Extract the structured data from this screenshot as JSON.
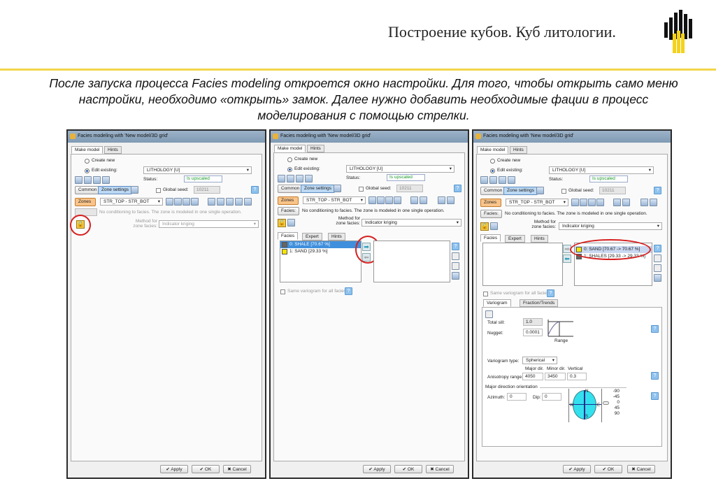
{
  "slide": {
    "title": "Построение кубов. Куб литологии.",
    "intro": "После запуска процесса Facies modeling откроется окно настройки. Для того, чтобы открыть само меню настройки, необходимо «открыть» замок. Далее нужно добавить необходимые фации в процесс моделирования с помощью стрелки.",
    "logo": "Rosneft logo"
  },
  "dialog": {
    "title": "Facies modeling with 'New model/3D grid'",
    "tab_make": "Make model",
    "tab_hints": "Hints",
    "create_new": "Create new",
    "edit_existing": "Edit existing:",
    "property": "LITHOLOGY [U]",
    "status_label": "Status:",
    "status_value": "Is upscaled",
    "common": "Common",
    "zone_settings": "Zone settings",
    "global_seed": "Global seed:",
    "seed_value": "10211",
    "zones": "Zones",
    "zone_value": "STR_TOP - STR_BOT",
    "facies_btn": "Facies:",
    "no_conditioning": "No conditioning to facies. The zone is modeled in one single operation.",
    "method_label": "Method for zone facies:",
    "method_value": "Indicator kriging",
    "apply": "Apply",
    "ok": "OK",
    "cancel": "Cancel"
  },
  "facies_tabs": {
    "facies": "Facies",
    "expert": "Expert",
    "hints": "Hints",
    "same_variogram": "Same variogram for all facies"
  },
  "dialog2": {
    "left_list": [
      {
        "label": "0: SHALE [70.67 %]",
        "color": "#666666"
      },
      {
        "label": "1: SAND [29.33 %]",
        "color": "#f5e400"
      }
    ]
  },
  "dialog3": {
    "right_list": [
      {
        "label": "0: SAND [70.67 -> 70.67 %]",
        "color": "#f5e400"
      },
      {
        "label": "1: SHALES [29.33 -> 29.33 %]",
        "color": "#666666"
      }
    ],
    "variogram_tab": "Variogram",
    "fraction_tab": "Fraction/Trends",
    "total_sill_label": "Total sill:",
    "total_sill": "1.0",
    "nugget_label": "Nugget:",
    "nugget": "0.0001",
    "range_label": "Range",
    "variogram_type_label": "Variogram type:",
    "variogram_type": "Spherical",
    "major_dir": "Major dir.",
    "minor_dir": "Minor dir.",
    "vertical": "Vertical",
    "anisotropy_label": "Anisotropy range:",
    "major_value": "4050",
    "minor_value": "3450",
    "vertical_value": "0.3",
    "orientation_label": "Major direction orientation",
    "azimuth_label": "Azimuth:",
    "azimuth": "0",
    "dip_label": "Dip:",
    "dip": "0",
    "compass": {
      "n": "N",
      "s": "S",
      "w": "W",
      "e": "E"
    },
    "dip_scale": [
      "-90",
      "-45",
      "0",
      "45",
      "90"
    ]
  },
  "colors": {
    "accent": "#f2d54a",
    "highlight": "#d62020"
  }
}
